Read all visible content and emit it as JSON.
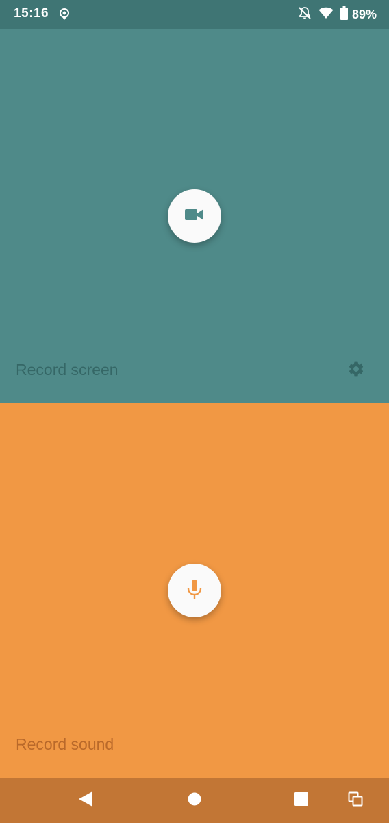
{
  "status_bar": {
    "time": "15:16",
    "battery_percent": "89%"
  },
  "record_screen": {
    "label": "Record screen",
    "button_icon": "video-camera-icon",
    "settings_icon": "gear-icon"
  },
  "record_sound": {
    "label": "Record sound",
    "button_icon": "microphone-icon"
  },
  "nav_bar": {
    "icons": [
      "back-icon",
      "home-icon",
      "recents-icon",
      "split-screen-icon"
    ]
  },
  "colors": {
    "status_bar": "#3f7574",
    "screen_panel": "#4f8a89",
    "screen_accent": "#4f8a89",
    "sound_panel": "#f19844",
    "sound_accent": "#f19844",
    "nav_bar": "#c27635"
  }
}
